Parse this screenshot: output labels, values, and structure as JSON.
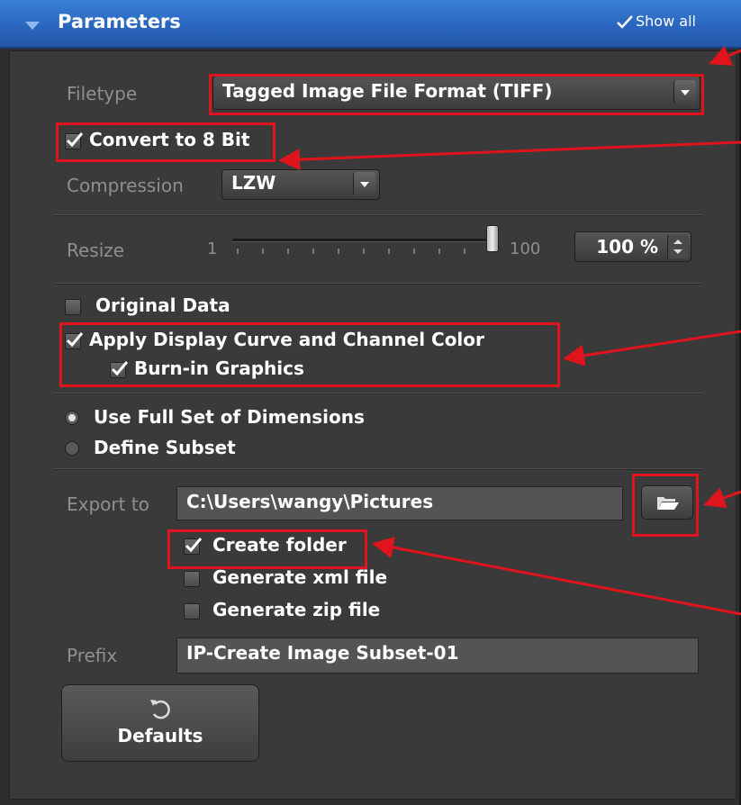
{
  "header": {
    "title": "Parameters",
    "show_all": "Show all"
  },
  "filetype": {
    "label": "Filetype",
    "value": "Tagged Image File Format (TIFF)"
  },
  "convert": {
    "label": "Convert to 8 Bit",
    "checked": true
  },
  "compression": {
    "label": "Compression",
    "value": "LZW"
  },
  "resize": {
    "label": "Resize",
    "min": "1",
    "max": "100",
    "value": "100 %",
    "fraction": 1.0
  },
  "options": {
    "original_data": {
      "label": "Original Data",
      "checked": false
    },
    "apply_display": {
      "label": "Apply Display Curve and Channel Color",
      "checked": true
    },
    "burn_in": {
      "label": "Burn-in Graphics",
      "checked": true
    }
  },
  "dimensions": {
    "full_set": {
      "label": "Use Full Set of Dimensions",
      "selected": true
    },
    "subset": {
      "label": "Define Subset",
      "selected": false
    }
  },
  "export": {
    "label": "Export to",
    "path": "C:\\Users\\wangy\\Pictures",
    "create_folder": {
      "label": "Create folder",
      "checked": true
    },
    "gen_xml": {
      "label": "Generate xml file",
      "checked": false
    },
    "gen_zip": {
      "label": "Generate zip file",
      "checked": false
    }
  },
  "prefix": {
    "label": "Prefix",
    "value": "IP-Create Image Subset-01"
  },
  "defaults_button": {
    "label": "Defaults"
  },
  "colors": {
    "panel": "#3a3a3a",
    "header": "#2a66bf",
    "annotation": "#e0141c"
  }
}
